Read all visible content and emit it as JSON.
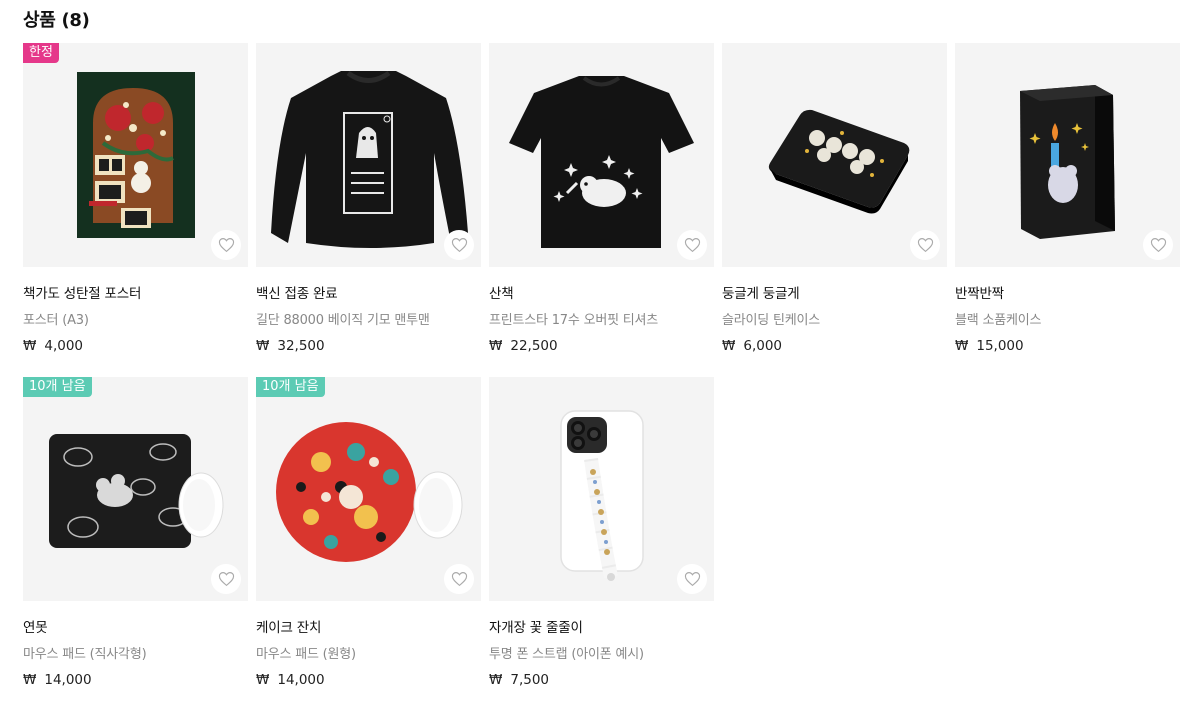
{
  "section": {
    "title": "상품 (8)"
  },
  "currency": "₩",
  "products": [
    {
      "badge": "한정",
      "badge_type": "limited",
      "name": "책가도 성탄절 포스터",
      "type": "포스터 (A3)",
      "price": "4,000",
      "art": "poster-icon"
    },
    {
      "badge": "",
      "badge_type": "",
      "name": "백신 접종 완료",
      "type": "길단 88000 베이직 기모 맨투맨",
      "price": "32,500",
      "art": "sweatshirt-icon"
    },
    {
      "badge": "",
      "badge_type": "",
      "name": "산책",
      "type": "프린트스타 17수 오버핏 티셔츠",
      "price": "22,500",
      "art": "tshirt-icon"
    },
    {
      "badge": "",
      "badge_type": "",
      "name": "둥글게 둥글게",
      "type": "슬라이딩 틴케이스",
      "price": "6,000",
      "art": "tin-case-icon"
    },
    {
      "badge": "",
      "badge_type": "",
      "name": "반짝반짝",
      "type": "블랙 소품케이스",
      "price": "15,000",
      "art": "box-icon"
    },
    {
      "badge": "10개 남음",
      "badge_type": "stock",
      "name": "연못",
      "type": "마우스 패드 (직사각형)",
      "price": "14,000",
      "art": "mousepad-rect-icon"
    },
    {
      "badge": "10개 남음",
      "badge_type": "stock",
      "name": "케이크 잔치",
      "type": "마우스 패드 (원형)",
      "price": "14,000",
      "art": "mousepad-round-icon"
    },
    {
      "badge": "",
      "badge_type": "",
      "name": "자개장 꽃 줄줄이",
      "type": "투명 폰 스트랩 (아이폰 예시)",
      "price": "7,500",
      "art": "phone-case-icon"
    }
  ]
}
